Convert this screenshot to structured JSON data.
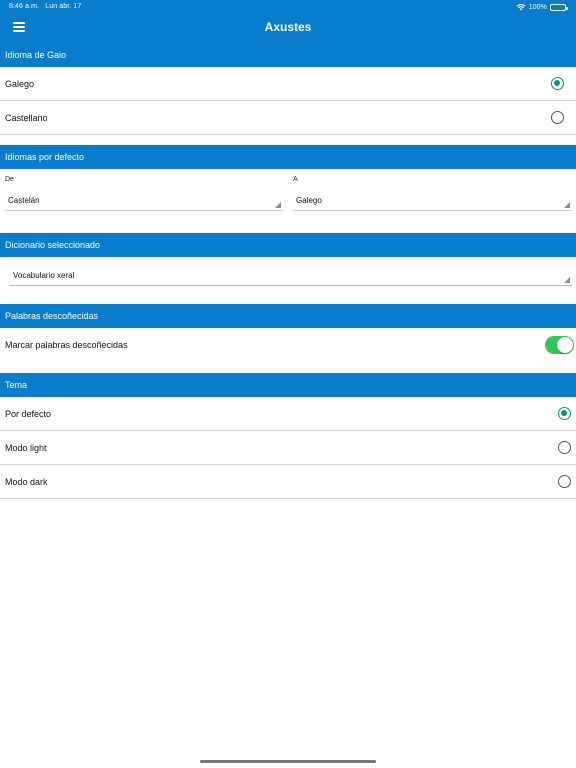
{
  "status_bar": {
    "time": "8:46 a.m.",
    "date": "Lun abr. 17",
    "battery": "100%"
  },
  "header": {
    "title": "Axustes",
    "menu_icon": "menu-icon"
  },
  "sections": {
    "language": {
      "title": "Idioma de Gaio",
      "options": [
        {
          "label": "Galego",
          "selected": true
        },
        {
          "label": "Castellano",
          "selected": false
        }
      ]
    },
    "default_languages": {
      "title": "Idiomas por defecto",
      "from_label": "De",
      "from_value": "Castelán",
      "to_label": "A",
      "to_value": "Galego"
    },
    "dictionary": {
      "title": "Dicionario seleccionado",
      "value": "Vocabulario xeral"
    },
    "unknown_words": {
      "title": "Palabras descoñecidas",
      "toggle_label": "Marcar palabras descoñecidas",
      "enabled": true
    },
    "theme": {
      "title": "Tema",
      "options": [
        {
          "label": "Por defecto",
          "selected": true
        },
        {
          "label": "Modo light",
          "selected": false
        },
        {
          "label": "Modo dark",
          "selected": false
        }
      ]
    }
  },
  "colors": {
    "accent": "#0a7ccc",
    "radio_selected": "#0b8f80",
    "toggle_on": "#34c759"
  }
}
